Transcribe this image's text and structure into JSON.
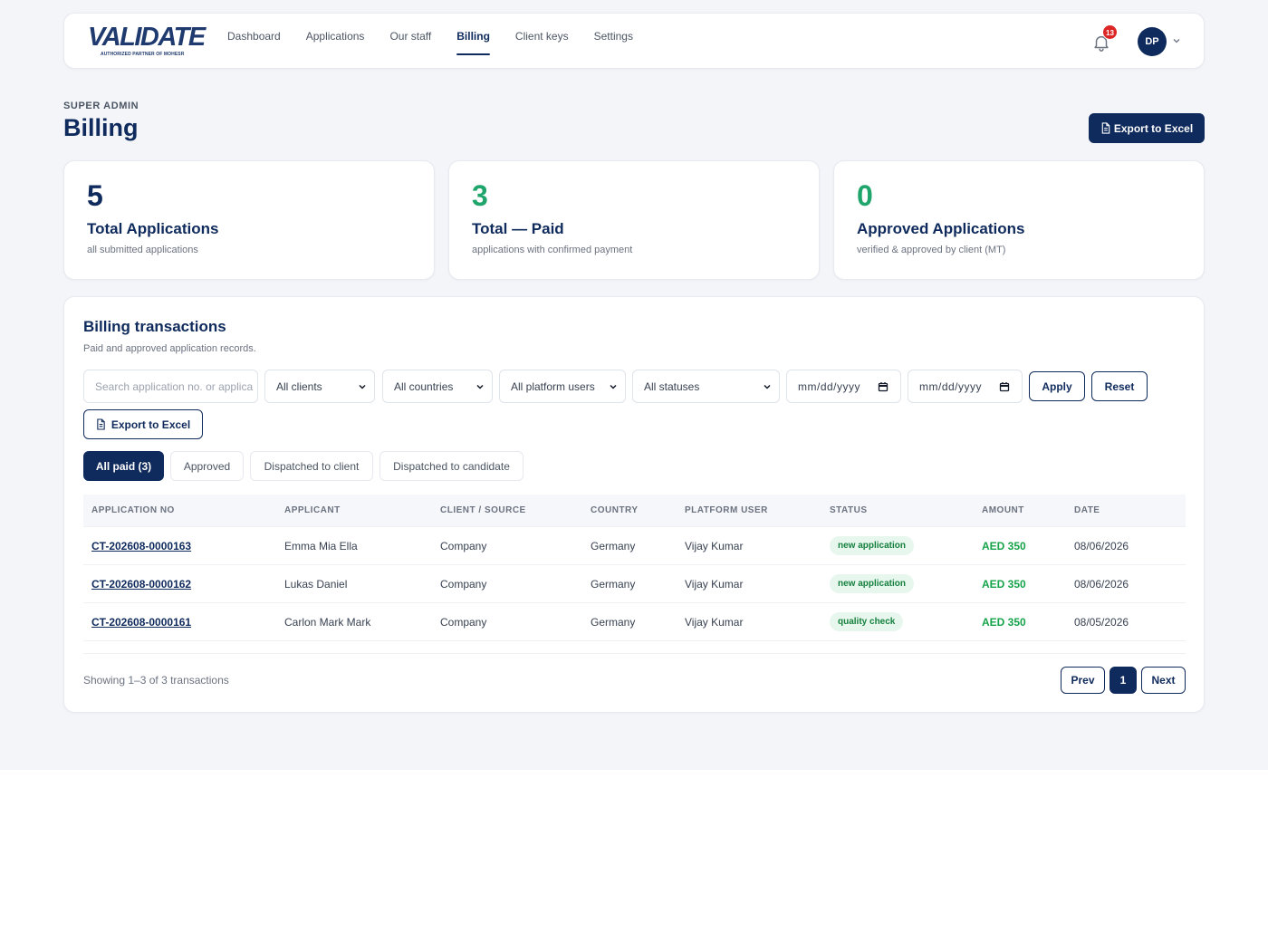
{
  "brand": {
    "name": "VALIDATE",
    "tagline": "AUTHORIZED PARTNER OF MOHESR"
  },
  "nav": {
    "links": [
      "Dashboard",
      "Applications",
      "Our staff",
      "Billing",
      "Client keys",
      "Settings"
    ],
    "active": "Billing",
    "notification_count": "13",
    "user_initials": "DP"
  },
  "header": {
    "eyebrow": "SUPER ADMIN",
    "title": "Billing",
    "export_label": "Export to Excel"
  },
  "stats": [
    {
      "value": "5",
      "label": "Total Applications",
      "sub": "all submitted applications",
      "color": "#0f2a5c"
    },
    {
      "value": "3",
      "label": "Total — Paid",
      "sub": "applications with confirmed payment",
      "color": "#1fa56b"
    },
    {
      "value": "0",
      "label": "Approved Applications",
      "sub": "verified & approved by client (MT)",
      "color": "#1fa56b"
    }
  ],
  "transactions": {
    "title": "Billing transactions",
    "subtitle": "Paid and approved application records.",
    "filters": {
      "search_placeholder": "Search application no. or applica",
      "client": "All clients",
      "country": "All countries",
      "platform_user": "All platform users",
      "status": "All statuses",
      "date_from": "mm/dd/yyyy",
      "date_to": "mm/dd/yyyy",
      "apply_label": "Apply",
      "reset_label": "Reset",
      "export_label": "Export to Excel"
    },
    "tabs": [
      "All paid (3)",
      "Approved",
      "Dispatched to client",
      "Dispatched to candidate"
    ],
    "columns": [
      "APPLICATION NO",
      "APPLICANT",
      "CLIENT / SOURCE",
      "COUNTRY",
      "PLATFORM USER",
      "STATUS",
      "AMOUNT",
      "DATE"
    ],
    "rows": [
      {
        "app_no": "CT-202608-0000163",
        "applicant": "Emma Mia Ella",
        "client": "Company",
        "country": "Germany",
        "platform_user": "Vijay Kumar",
        "status": "new application",
        "amount": "AED 350",
        "date": "08/06/2026"
      },
      {
        "app_no": "CT-202608-0000162",
        "applicant": "Lukas Daniel",
        "client": "Company",
        "country": "Germany",
        "platform_user": "Vijay Kumar",
        "status": "new application",
        "amount": "AED 350",
        "date": "08/06/2026"
      },
      {
        "app_no": "CT-202608-0000161",
        "applicant": "Carlon Mark Mark",
        "client": "Company",
        "country": "Germany",
        "platform_user": "Vijay Kumar",
        "status": "quality check",
        "amount": "AED 350",
        "date": "08/05/2026"
      }
    ],
    "showing": "Showing 1–3 of 3 transactions",
    "pagination": {
      "prev": "Prev",
      "current": "1",
      "next": "Next"
    }
  }
}
